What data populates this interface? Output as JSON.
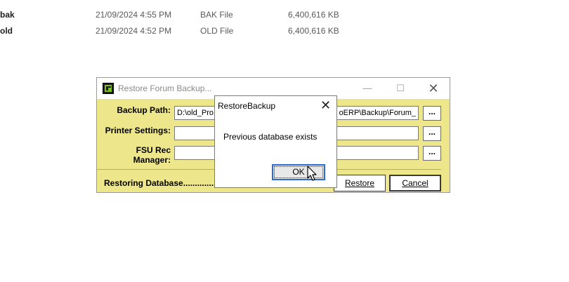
{
  "explorer": {
    "rows": [
      {
        "name": "bak",
        "date": "21/09/2024 4:55 PM",
        "type": "BAK File",
        "size": "6,400,616 KB"
      },
      {
        "name": "old",
        "date": "21/09/2024 4:52 PM",
        "type": "OLD File",
        "size": "6,400,616 KB"
      }
    ]
  },
  "window": {
    "title": "Restore Forum Backup...",
    "min_glyph": "—",
    "max_glyph": "☐",
    "close_glyph": "✕",
    "labels": {
      "backup_path": "Backup Path:",
      "printer_settings": "Printer Settings:",
      "fsu_rec_manager": "FSU Rec Manager:"
    },
    "backup_path_value_start": "D:\\old_Pro",
    "backup_path_value_end": "oERP\\Backup\\Forum_",
    "printer_settings_value": "",
    "fsu_rec_manager_value": "",
    "browse_label": "...",
    "status_text": "Restoring Database...............",
    "restore_label": "Restore",
    "cancel_label": "Cancel"
  },
  "dialog": {
    "title": "RestoreBackup",
    "close_glyph": "✕",
    "message": "Previous database exists",
    "ok_label": "OK"
  },
  "colors": {
    "window_bg": "#ede68a",
    "ok_focus_border": "#2b6bd6"
  },
  "icons": {
    "app": "forum-logo-icon",
    "cursor": "mouse-pointer-icon"
  }
}
